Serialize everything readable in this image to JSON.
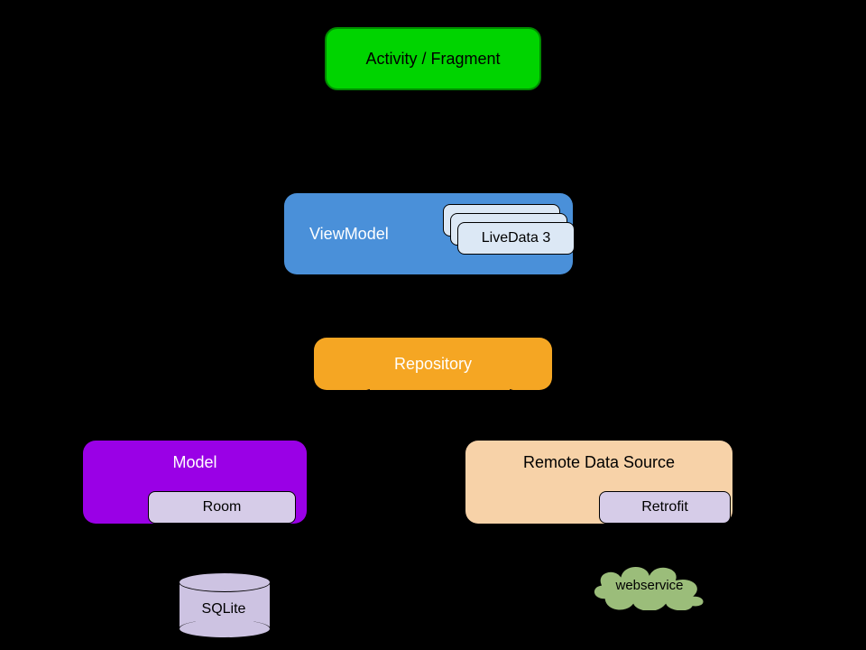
{
  "activity": {
    "label": "Activity / Fragment",
    "fill": "#00d400"
  },
  "viewmodel": {
    "label": "ViewModel",
    "fill": "#4a90d9",
    "livedata": {
      "label": "LiveData 3",
      "fill": "#dce8f5"
    }
  },
  "repository": {
    "label": "Repository",
    "fill": "#f5a623"
  },
  "model": {
    "label": "Model",
    "fill": "#9a00e6",
    "room": {
      "label": "Room",
      "fill": "#d6cce8"
    }
  },
  "remote": {
    "label": "Remote Data Source",
    "fill": "#f7d2a8",
    "retrofit": {
      "label": "Retrofit",
      "fill": "#d6cce8"
    }
  },
  "sqlite": {
    "label": "SQLite",
    "fill": "#cdc3e2"
  },
  "webservice": {
    "label": "webservice",
    "fill": "#9bbd7a"
  }
}
